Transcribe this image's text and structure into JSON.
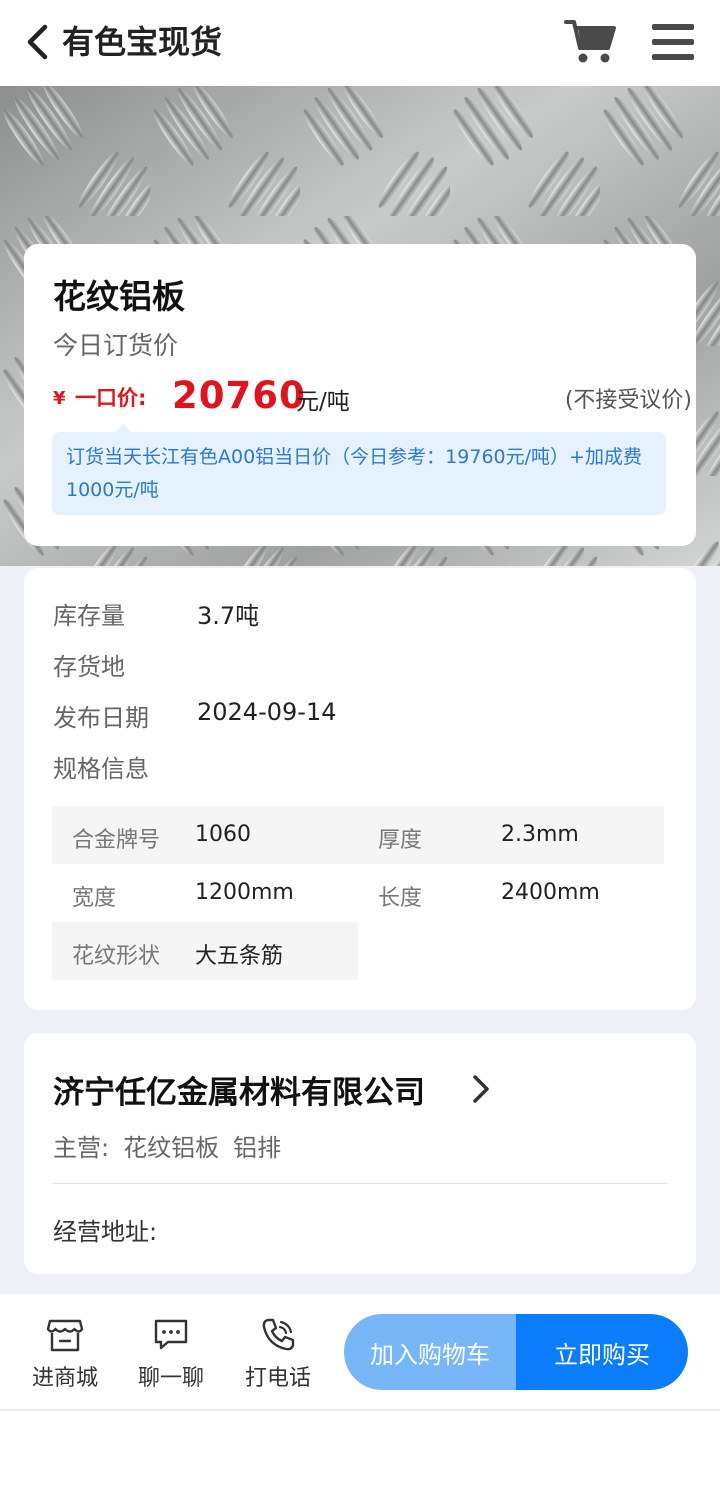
{
  "header": {
    "title": "有色宝现货",
    "back_icon": "chevron-left-icon",
    "cart_icon": "cart-icon",
    "menu_icon": "hamburger-menu-icon"
  },
  "banner": {
    "image": "aluminum-tread-plate-photo"
  },
  "product": {
    "name": "花纹铝板",
    "subtitle": "今日订货价",
    "currency": "¥",
    "price_label": "一口价:",
    "price": "20760",
    "price_unit": "元/吨",
    "price_note": "(不接受议价)",
    "notice": "订货当天长江有色A00铝当日价（今日参考：19760元/吨）+加成费1000元/吨"
  },
  "info": {
    "rows": [
      {
        "label": "库存量",
        "value": "3.7吨"
      },
      {
        "label": "存货地",
        "value": ""
      },
      {
        "label": "发布日期",
        "value": "2024-09-14"
      },
      {
        "label": "规格信息",
        "value": ""
      }
    ],
    "specs": [
      {
        "key": "合金牌号",
        "value": "1060"
      },
      {
        "key": "厚度",
        "value": "2.3mm"
      },
      {
        "key": "宽度",
        "value": "1200mm"
      },
      {
        "key": "长度",
        "value": "2400mm"
      },
      {
        "key": "花纹形状",
        "value": "大五条筋"
      }
    ]
  },
  "company": {
    "name": "济宁任亿金属材料有限公司",
    "main_label": "主营:",
    "main_items": [
      "花纹铝板",
      "铝排"
    ],
    "address_label": "经营地址:"
  },
  "bottom_bar": {
    "actions": [
      {
        "label": "进商城",
        "icon": "store-icon"
      },
      {
        "label": "聊一聊",
        "icon": "chat-icon"
      },
      {
        "label": "打电话",
        "icon": "phone-icon"
      }
    ],
    "add_to_cart": "加入购物车",
    "buy_now": "立即购买"
  },
  "colors": {
    "price_red": "#e0141e",
    "accent_blue": "#0b7dfa",
    "light_blue": "#76b6f9",
    "notice_bg": "#e5f1fd",
    "notice_text": "#2a7ad1"
  }
}
